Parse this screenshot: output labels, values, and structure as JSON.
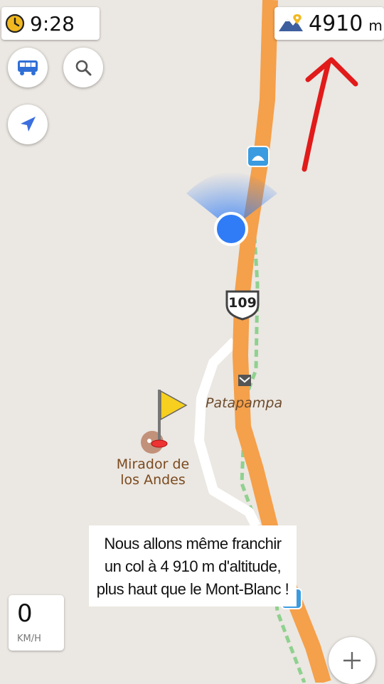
{
  "status": {
    "time": "9:28",
    "altitude_value": "4910",
    "altitude_unit": "m"
  },
  "speed": {
    "value": "0",
    "unit": "KM/H"
  },
  "map": {
    "route_number": "109",
    "labels": {
      "patapampa": "Patapampa",
      "mirador_line1": "Mirador de",
      "mirador_line2": "los Andes"
    }
  },
  "caption": {
    "line1": "Nous allons même franchir",
    "line2": "un col à 4 910 m d'altitude,",
    "line3": "plus haut que le Mont-Blanc !"
  },
  "colors": {
    "road": "#f5a04a",
    "trail": "#8fd18f",
    "location": "#2f7cf6",
    "annotation_arrow": "#e11a1a",
    "flag": "#f6cf1f"
  },
  "icons": {
    "clock": "clock-icon",
    "altitude": "mountain-pin-icon",
    "transport": "bus-icon",
    "search": "search-icon",
    "navigate": "navigation-arrow-icon",
    "zoom": "plus-icon"
  }
}
